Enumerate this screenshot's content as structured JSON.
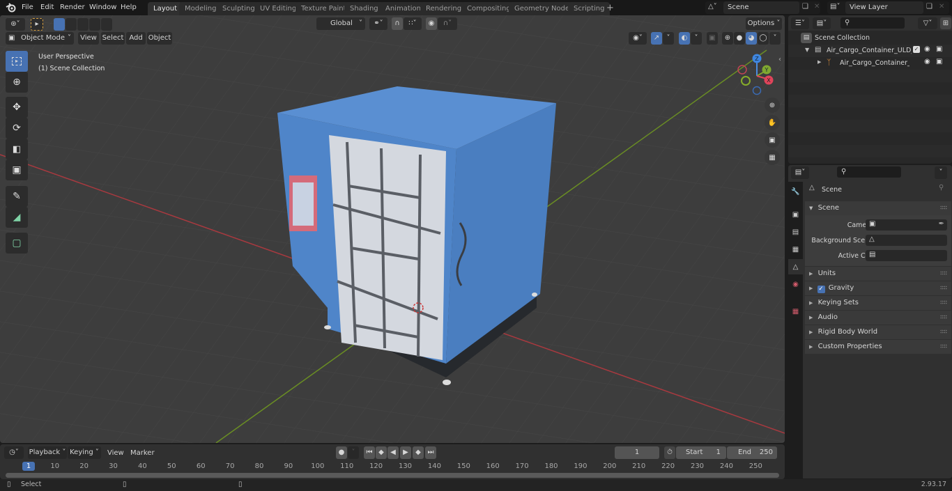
{
  "menu": {
    "items": [
      "File",
      "Edit",
      "Render",
      "Window",
      "Help"
    ]
  },
  "workspaces": [
    {
      "label": "Layout",
      "active": true
    },
    {
      "label": "Modeling"
    },
    {
      "label": "Sculpting"
    },
    {
      "label": "UV Editing"
    },
    {
      "label": "Texture Paint"
    },
    {
      "label": "Shading"
    },
    {
      "label": "Animation"
    },
    {
      "label": "Rendering"
    },
    {
      "label": "Compositing"
    },
    {
      "label": "Geometry Nodes"
    },
    {
      "label": "Scripting"
    }
  ],
  "add_workspace": "+",
  "scene_selector": {
    "value": "Scene"
  },
  "view_layer_selector": {
    "value": "View Layer"
  },
  "viewport": {
    "mode": "Object Mode",
    "menus": [
      "View",
      "Select",
      "Add",
      "Object"
    ],
    "transform_orientation": "Global",
    "options_label": "Options",
    "overlay_text": [
      "User Perspective",
      "(1) Scene Collection"
    ],
    "gizmo": {
      "x": "X",
      "y": "Y",
      "z": "Z"
    },
    "colors": {
      "background": "#3d3d3d",
      "grid": "#474747",
      "x_axis": "#a8393f",
      "y_axis": "#6a8e23",
      "container_blue": "#4f85c9",
      "door_white": "#d4d8df",
      "active_blue": "#4772b3"
    }
  },
  "outliner": {
    "root": "Scene Collection",
    "items": [
      {
        "label": "Air_Cargo_Container_ULD_LD",
        "type": "collection",
        "expanded": true,
        "checked": true
      },
      {
        "label": "Air_Cargo_Container_ULI",
        "type": "empty",
        "expanded": false
      }
    ]
  },
  "properties": {
    "context": "Scene",
    "panel_title": "Scene",
    "fields": [
      {
        "label": "Camera",
        "value": ""
      },
      {
        "label": "Background Scene",
        "value": ""
      },
      {
        "label": "Active Clip",
        "value": ""
      }
    ],
    "subpanels": [
      {
        "label": "Units"
      },
      {
        "label": "Gravity",
        "checkbox": true
      },
      {
        "label": "Keying Sets"
      },
      {
        "label": "Audio"
      },
      {
        "label": "Rigid Body World"
      },
      {
        "label": "Custom Properties"
      }
    ]
  },
  "timeline": {
    "menus": [
      "Playback",
      "Keying",
      "View",
      "Marker"
    ],
    "current_frame": "1",
    "start_label": "Start",
    "start": "1",
    "end_label": "End",
    "end": "250",
    "playhead": "1",
    "ticks": [
      "10",
      "20",
      "30",
      "40",
      "50",
      "60",
      "70",
      "80",
      "90",
      "100",
      "110",
      "120",
      "130",
      "140",
      "150",
      "160",
      "170",
      "180",
      "190",
      "200",
      "210",
      "220",
      "230",
      "240",
      "250"
    ]
  },
  "statusbar": {
    "left_action": "Select",
    "version": "2.93.17"
  }
}
